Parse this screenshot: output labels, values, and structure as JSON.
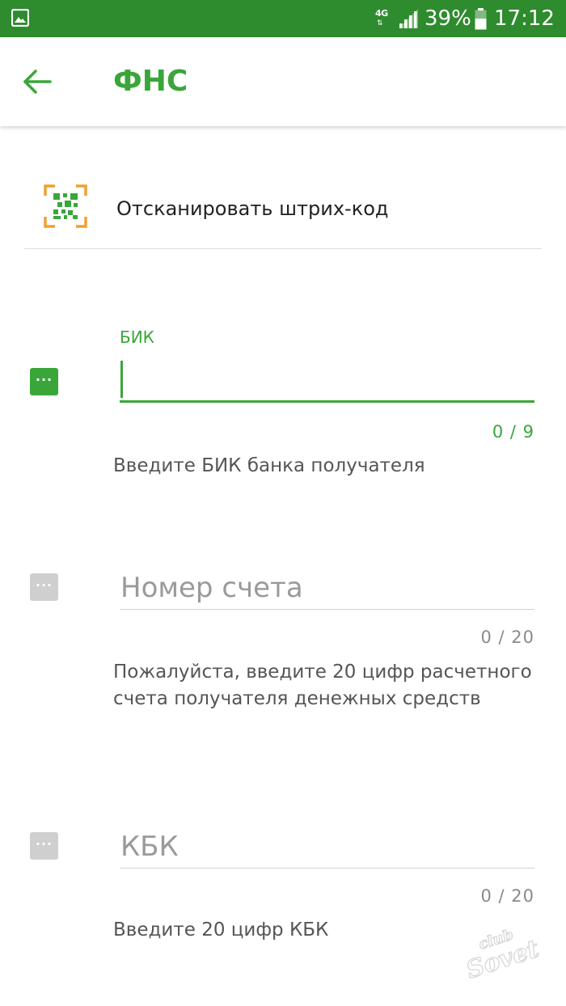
{
  "status_bar": {
    "network": "4G",
    "battery_percent": "39%",
    "time": "17:12"
  },
  "app_bar": {
    "title": "ФНС"
  },
  "scan": {
    "label": "Отсканировать штрих-код"
  },
  "fields": {
    "bik": {
      "label": "БИК",
      "value": "",
      "counter": "0 / 9",
      "hint": "Введите БИК банка получателя"
    },
    "account": {
      "placeholder": "Номер счета",
      "value": "",
      "counter": "0 / 20",
      "hint": "Пожалуйста, введите 20 цифр расчетного счета получателя денежных средств"
    },
    "kbk": {
      "placeholder": "КБК",
      "value": "",
      "counter": "0 / 20",
      "hint": "Введите 20 цифр КБК"
    }
  },
  "field_icon_glyph": "···",
  "watermark": {
    "line1": "club",
    "line2": "Sovet"
  },
  "colors": {
    "status_bar": "#2e8b2e",
    "accent_green": "#3aa63a",
    "inactive_icon": "#cfcfcf",
    "barcode_frame": "#f0a030"
  },
  "icons": {
    "status_gallery": "image-icon",
    "status_signal": "signal-icon",
    "status_battery": "battery-icon",
    "back": "arrow-left-icon",
    "scan": "barcode-scan-icon",
    "field": "ellipsis-icon"
  }
}
